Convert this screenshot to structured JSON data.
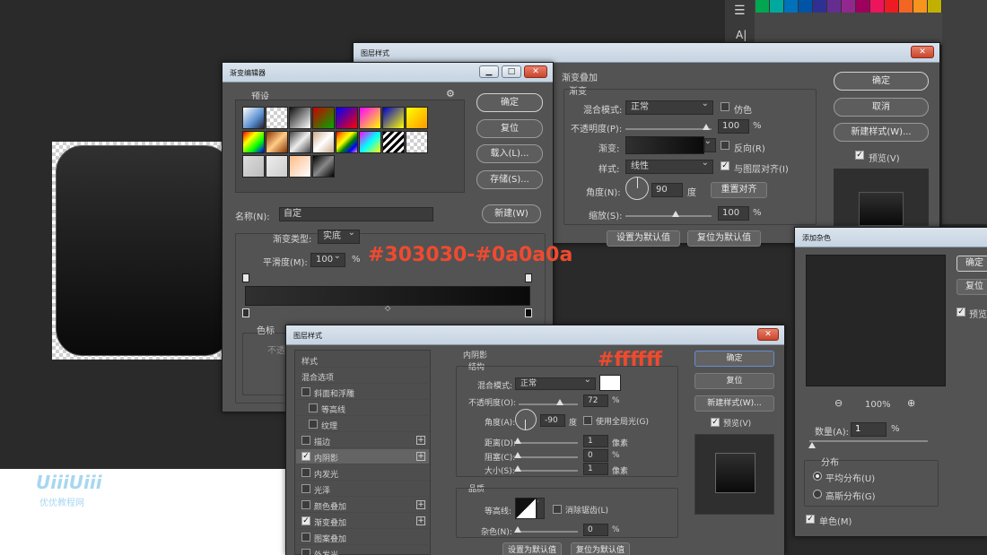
{
  "annotations": {
    "gradient_colors": "#303030-#0a0a0a",
    "shadow_color": "#ffffff"
  },
  "watermark": {
    "logo": "UiiiUiii",
    "caption": "优优教程网"
  },
  "swatch_colors": [
    "#00a650",
    "#00a99d",
    "#0072bc",
    "#0054a6",
    "#2e3192",
    "#662d91",
    "#92278f",
    "#9e005d",
    "#ed145b",
    "#ed1c24",
    "#f26522",
    "#f7941d",
    "#c2b000"
  ],
  "layer_style_back": {
    "title": "图层样式",
    "section": "渐变叠加",
    "subsection": "渐变",
    "blend_label": "混合模式:",
    "blend_value": "正常",
    "dither_label": "仿色",
    "opacity_label": "不透明度(P):",
    "opacity_value": "100",
    "pct": "%",
    "gradient_label": "渐变:",
    "reverse_label": "反向(R)",
    "style_label": "样式:",
    "style_value": "线性",
    "align_label": "与图层对齐(I)",
    "angle_label": "角度(N):",
    "angle_value": "90",
    "deg": "度",
    "reset_align": "重置对齐",
    "scale_label": "缩放(S):",
    "scale_value": "100",
    "set_default": "设置为默认值",
    "reset_default": "复位为默认值",
    "ok": "确定",
    "cancel": "取消",
    "new_style": "新建样式(W)...",
    "preview": "预览(V)"
  },
  "gradient_editor": {
    "title": "渐变编辑器",
    "presets_label": "预设",
    "ok": "确定",
    "reset": "复位",
    "load": "载入(L)...",
    "save": "存储(S)...",
    "name_label": "名称(N):",
    "name_value": "自定",
    "new": "新建(W)",
    "type_label": "渐变类型:",
    "type_value": "实底",
    "smooth_label": "平滑度(M):",
    "smooth_value": "100",
    "pct": "%",
    "stops_label": "色标",
    "opacity_hint": "不透"
  },
  "layer_style_front": {
    "title": "图层样式",
    "styles_header": "样式",
    "list": [
      {
        "label": "混合选项",
        "check": "none",
        "plus": false
      },
      {
        "label": "斜面和浮雕",
        "check": "off",
        "plus": false
      },
      {
        "label": "等高线",
        "check": "off",
        "plus": false,
        "indent": true
      },
      {
        "label": "纹理",
        "check": "off",
        "plus": false,
        "indent": true
      },
      {
        "label": "描边",
        "check": "off",
        "plus": true
      },
      {
        "label": "内阴影",
        "check": "on",
        "plus": true,
        "selected": true
      },
      {
        "label": "内发光",
        "check": "off",
        "plus": false
      },
      {
        "label": "光泽",
        "check": "off",
        "plus": false
      },
      {
        "label": "颜色叠加",
        "check": "off",
        "plus": true
      },
      {
        "label": "渐变叠加",
        "check": "on",
        "plus": true
      },
      {
        "label": "图案叠加",
        "check": "off",
        "plus": false
      },
      {
        "label": "外发光",
        "check": "off",
        "plus": false
      }
    ],
    "section": "内阴影",
    "structure": "结构",
    "blend_label": "混合模式:",
    "blend_value": "正常",
    "opacity_label": "不透明度(O):",
    "opacity_value": "72",
    "pct": "%",
    "angle_label": "角度(A):",
    "angle_value": "-90",
    "deg": "度",
    "global_light": "使用全局光(G)",
    "distance_label": "距离(D):",
    "distance_value": "1",
    "px": "像素",
    "choke_label": "阻塞(C):",
    "choke_value": "0",
    "size_label": "大小(S):",
    "size_value": "1",
    "quality": "品质",
    "contour_label": "等高线:",
    "antialias": "消除锯齿(L)",
    "noise_label": "杂色(N):",
    "noise_value": "0",
    "set_default": "设置为默认值",
    "reset_default": "复位为默认值",
    "ok": "确定",
    "reset": "复位",
    "new_style": "新建样式(W)...",
    "preview": "预览(V)"
  },
  "add_noise": {
    "title": "添加杂色",
    "ok": "确定",
    "reset": "复位",
    "preview": "预览",
    "zoom": "100%",
    "amount_label": "数量(A):",
    "amount_value": "1",
    "pct": "%",
    "dist_label": "分布",
    "uniform": "平均分布(U)",
    "gaussian": "高斯分布(G)",
    "mono": "单色(M)"
  }
}
